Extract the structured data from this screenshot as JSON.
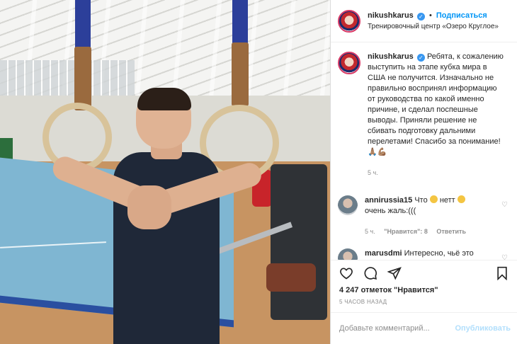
{
  "post": {
    "username": "nikushkarus",
    "follow_label": "Подписаться",
    "separator": "•",
    "location": "Тренировочный центр «Озеро Круглое»",
    "caption": {
      "username": "nikushkarus",
      "text": "Ребята, к сожалению выступить на этапе кубка мира в США не получится. Изначально не правильно воспринял информацию от руководства по какой именно причине, и сделал поспешные выводы. Приняли решение не сбивать подготовку дальними перелетами! Спасибо за понимание!",
      "time": "5 ч."
    },
    "comments": [
      {
        "username": "annirussia15",
        "text_before": "Что",
        "text_middle": " нетт",
        "text_after": "очень жаль:(((",
        "time": "5 ч.",
        "likes_label": "\"Нравится\": 8",
        "reply_label": "Ответить"
      },
      {
        "username": "marusdmi",
        "text": "Интересно, чьё это решение?"
      }
    ],
    "likes_text": "4 247 отметок \"Нравится\"",
    "posted_ago": "5 ЧАСОВ НАЗАД",
    "comment_placeholder": "Добавьте комментарий...",
    "publish_label": "Опубликовать"
  },
  "icons": {
    "verified": "verified-badge-icon",
    "like": "heart-icon",
    "comment": "comment-icon",
    "share": "paper-plane-icon",
    "save": "bookmark-icon",
    "comment_like": "small-heart-icon"
  },
  "colors": {
    "accent": "#0095f6",
    "publish_disabled": "#b2dffc",
    "muted": "#8e8e8e"
  }
}
